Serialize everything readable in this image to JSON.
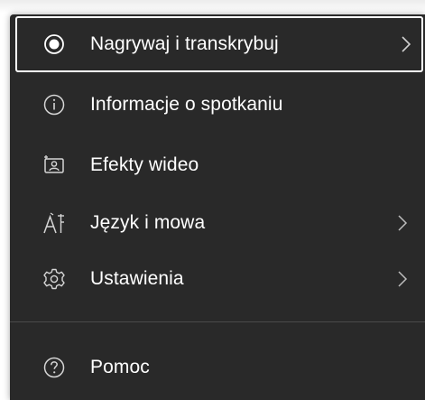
{
  "menu": {
    "items": [
      {
        "label": "Nagrywaj i transkrybuj",
        "icon": "record-icon",
        "submenu": true,
        "focused": true
      },
      {
        "label": "Informacje o spotkaniu",
        "icon": "info-icon",
        "submenu": false
      },
      {
        "label": "Efekty wideo",
        "icon": "video-effects-icon",
        "submenu": false
      },
      {
        "label": "Język i mowa",
        "icon": "language-icon",
        "submenu": true
      },
      {
        "label": "Ustawienia",
        "icon": "gear-icon",
        "submenu": true
      }
    ],
    "footer_items": [
      {
        "label": "Pomoc",
        "icon": "help-icon",
        "submenu": false
      }
    ]
  },
  "colors": {
    "menu_background": "#292929",
    "text": "#ffffff",
    "icon": "#d6d6d6",
    "divider": "#4a4a4a",
    "focus_outline": "#ffffff"
  }
}
